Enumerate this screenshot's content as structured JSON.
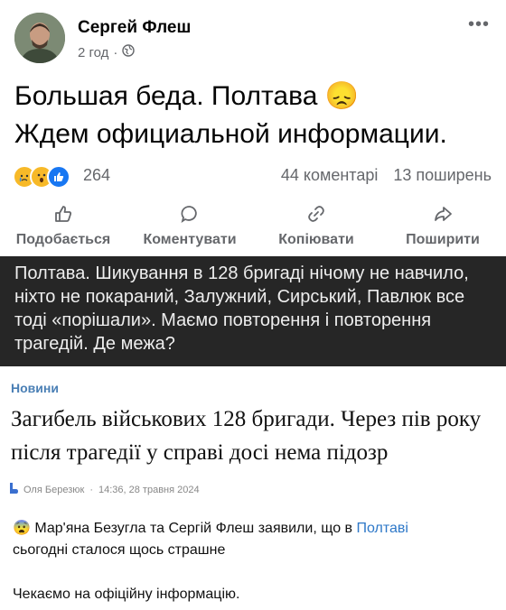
{
  "post": {
    "author": "Сергей Флеш",
    "time": "2 год",
    "separator": "·",
    "more_label": "•••",
    "text_line1": "Большая беда. Полтава",
    "text_line1_emoji": "😞",
    "text_line2": "Ждем официальной информации.",
    "reactions": {
      "icons": [
        "sad-reaction-icon",
        "wow-reaction-icon",
        "like-reaction-icon"
      ],
      "count": "264",
      "comments": "44 коментарі",
      "shares": "13 поширень"
    },
    "actions": [
      {
        "label": "Подобається",
        "icon": "thumbs-up-icon"
      },
      {
        "label": "Коментувати",
        "icon": "comment-icon"
      },
      {
        "label": "Копіювати",
        "icon": "link-icon"
      },
      {
        "label": "Поширити",
        "icon": "share-icon"
      }
    ]
  },
  "overlay": {
    "text": "Полтава. Шикування в 128 бригаді нічому не навчило, ніхто не покараний, Залужний, Сирський, Павлюк все тоді «порішали». Маємо повторення і повторення трагедій. Де межа?"
  },
  "news": {
    "tag": "Новини",
    "headline": "Загибель військових 128 бригади. Через пів року після трагедії у справі досі нема підозр",
    "byline_author": "Оля Березюк",
    "byline_date": "14:36, 28 травня 2024"
  },
  "tg": {
    "emoji": "😨",
    "line1_before": "Мар'яна Безугла та Сергій Флеш заявили, що в ",
    "line1_link": "Полтаві",
    "line1_after": "сьогодні сталося щось страшне",
    "line2": "Чекаємо на офіційну інформацію."
  },
  "colors": {
    "facebook_gray": "#65676b",
    "dark_overlay": "#262626",
    "news_tag": "#4a7fb5",
    "link": "#2e78c8"
  }
}
